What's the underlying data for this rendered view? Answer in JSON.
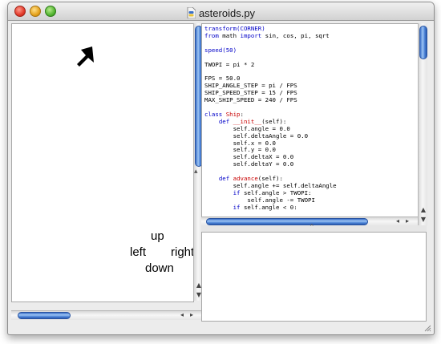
{
  "window": {
    "title": "asteroids.py",
    "file_icon": "python-file-icon"
  },
  "canvas": {
    "ship_icon": "ship-arrow-icon",
    "controls": {
      "up": "up",
      "left": "left",
      "right": "right",
      "down": "down"
    }
  },
  "editor": {
    "lines": [
      [
        {
          "t": "transform(CORNER)",
          "c": "bi"
        }
      ],
      [
        {
          "t": "from",
          "c": "kw"
        },
        {
          "t": " math "
        },
        {
          "t": "import",
          "c": "kw"
        },
        {
          "t": " sin, cos, pi, sqrt"
        }
      ],
      [
        {
          "t": ""
        }
      ],
      [
        {
          "t": "speed(50)",
          "c": "bi"
        }
      ],
      [
        {
          "t": ""
        }
      ],
      [
        {
          "t": "TWOPI = pi * 2"
        }
      ],
      [
        {
          "t": ""
        }
      ],
      [
        {
          "t": "FPS = 50.0"
        }
      ],
      [
        {
          "t": "SHIP_ANGLE_STEP = pi / FPS"
        }
      ],
      [
        {
          "t": "SHIP_SPEED_STEP = 15 / FPS"
        }
      ],
      [
        {
          "t": "MAX_SHIP_SPEED = 240 / FPS"
        }
      ],
      [
        {
          "t": ""
        }
      ],
      [
        {
          "t": "class",
          "c": "kw"
        },
        {
          "t": " "
        },
        {
          "t": "Ship",
          "c": "fn"
        },
        {
          "t": ":"
        }
      ],
      [
        {
          "t": "    "
        },
        {
          "t": "def",
          "c": "kw"
        },
        {
          "t": " "
        },
        {
          "t": "__init__",
          "c": "fn"
        },
        {
          "t": "(self):"
        }
      ],
      [
        {
          "t": "        self.angle = 0.0"
        }
      ],
      [
        {
          "t": "        self.deltaAngle = 0.0"
        }
      ],
      [
        {
          "t": "        self.x = 0.0"
        }
      ],
      [
        {
          "t": "        self.y = 0.0"
        }
      ],
      [
        {
          "t": "        self.deltaX = 0.0"
        }
      ],
      [
        {
          "t": "        self.deltaY = 0.0"
        }
      ],
      [
        {
          "t": ""
        }
      ],
      [
        {
          "t": "    "
        },
        {
          "t": "def",
          "c": "kw"
        },
        {
          "t": " "
        },
        {
          "t": "advance",
          "c": "fn"
        },
        {
          "t": "(self):"
        }
      ],
      [
        {
          "t": "        self.angle += self.deltaAngle"
        }
      ],
      [
        {
          "t": "        "
        },
        {
          "t": "if",
          "c": "kw"
        },
        {
          "t": " self.angle > TWOPI:"
        }
      ],
      [
        {
          "t": "            self.angle -= TWOPI"
        }
      ],
      [
        {
          "t": "        "
        },
        {
          "t": "if",
          "c": "kw"
        },
        {
          "t": " self.angle < 0:"
        }
      ]
    ]
  },
  "scrollbars": {
    "arrow_up": "▲",
    "arrow_down": "▼",
    "arrow_left": "◂",
    "arrow_right": "▸",
    "split_up": "▴",
    "split_handle": "⌃"
  },
  "colors": {
    "keyword": "#0000c8",
    "defname": "#c80000",
    "thumb": "#4b82d6"
  }
}
